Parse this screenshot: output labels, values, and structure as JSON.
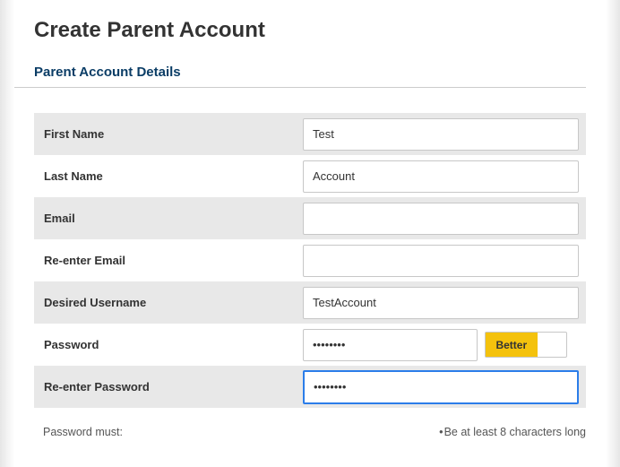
{
  "header": {
    "page_title": "Create Parent Account",
    "section_title": "Parent Account Details"
  },
  "form": {
    "first_name": {
      "label": "First Name",
      "value": "Test"
    },
    "last_name": {
      "label": "Last Name",
      "value": "Account"
    },
    "email": {
      "label": "Email",
      "value": ""
    },
    "re_email": {
      "label": "Re-enter Email",
      "value": ""
    },
    "username": {
      "label": "Desired Username",
      "value": "TestAccount"
    },
    "password": {
      "label": "Password",
      "value": "••••••••",
      "strength_label": "Better"
    },
    "re_password": {
      "label": "Re-enter Password",
      "value": "••••••••"
    }
  },
  "password_rules": {
    "intro": "Password must:",
    "rule1": "Be at least 8 characters long"
  }
}
